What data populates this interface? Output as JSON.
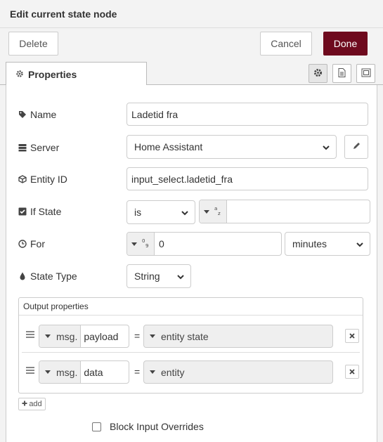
{
  "title": "Edit current state node",
  "toolbar": {
    "delete_label": "Delete",
    "cancel_label": "Cancel",
    "done_label": "Done"
  },
  "tab": {
    "label": "Properties"
  },
  "fields": {
    "name": {
      "label": "Name",
      "value": "Ladetid fra"
    },
    "server": {
      "label": "Server",
      "value": "Home Assistant"
    },
    "entity_id": {
      "label": "Entity ID",
      "value": "input_select.ladetid_fra"
    },
    "if_state": {
      "label": "If State",
      "operator": "is",
      "value": ""
    },
    "for": {
      "label": "For",
      "value": "0",
      "unit": "minutes"
    },
    "state_type": {
      "label": "State Type",
      "value": "String"
    }
  },
  "output": {
    "header": "Output properties",
    "rows": [
      {
        "prefix": "msg.",
        "property": "payload",
        "equals": "=",
        "value": "entity state"
      },
      {
        "prefix": "msg.",
        "property": "data",
        "equals": "=",
        "value": "entity"
      }
    ]
  },
  "add_label": "add",
  "block_input": {
    "label": "Block Input Overrides"
  },
  "colors": {
    "primary": "#6e0a1e"
  }
}
